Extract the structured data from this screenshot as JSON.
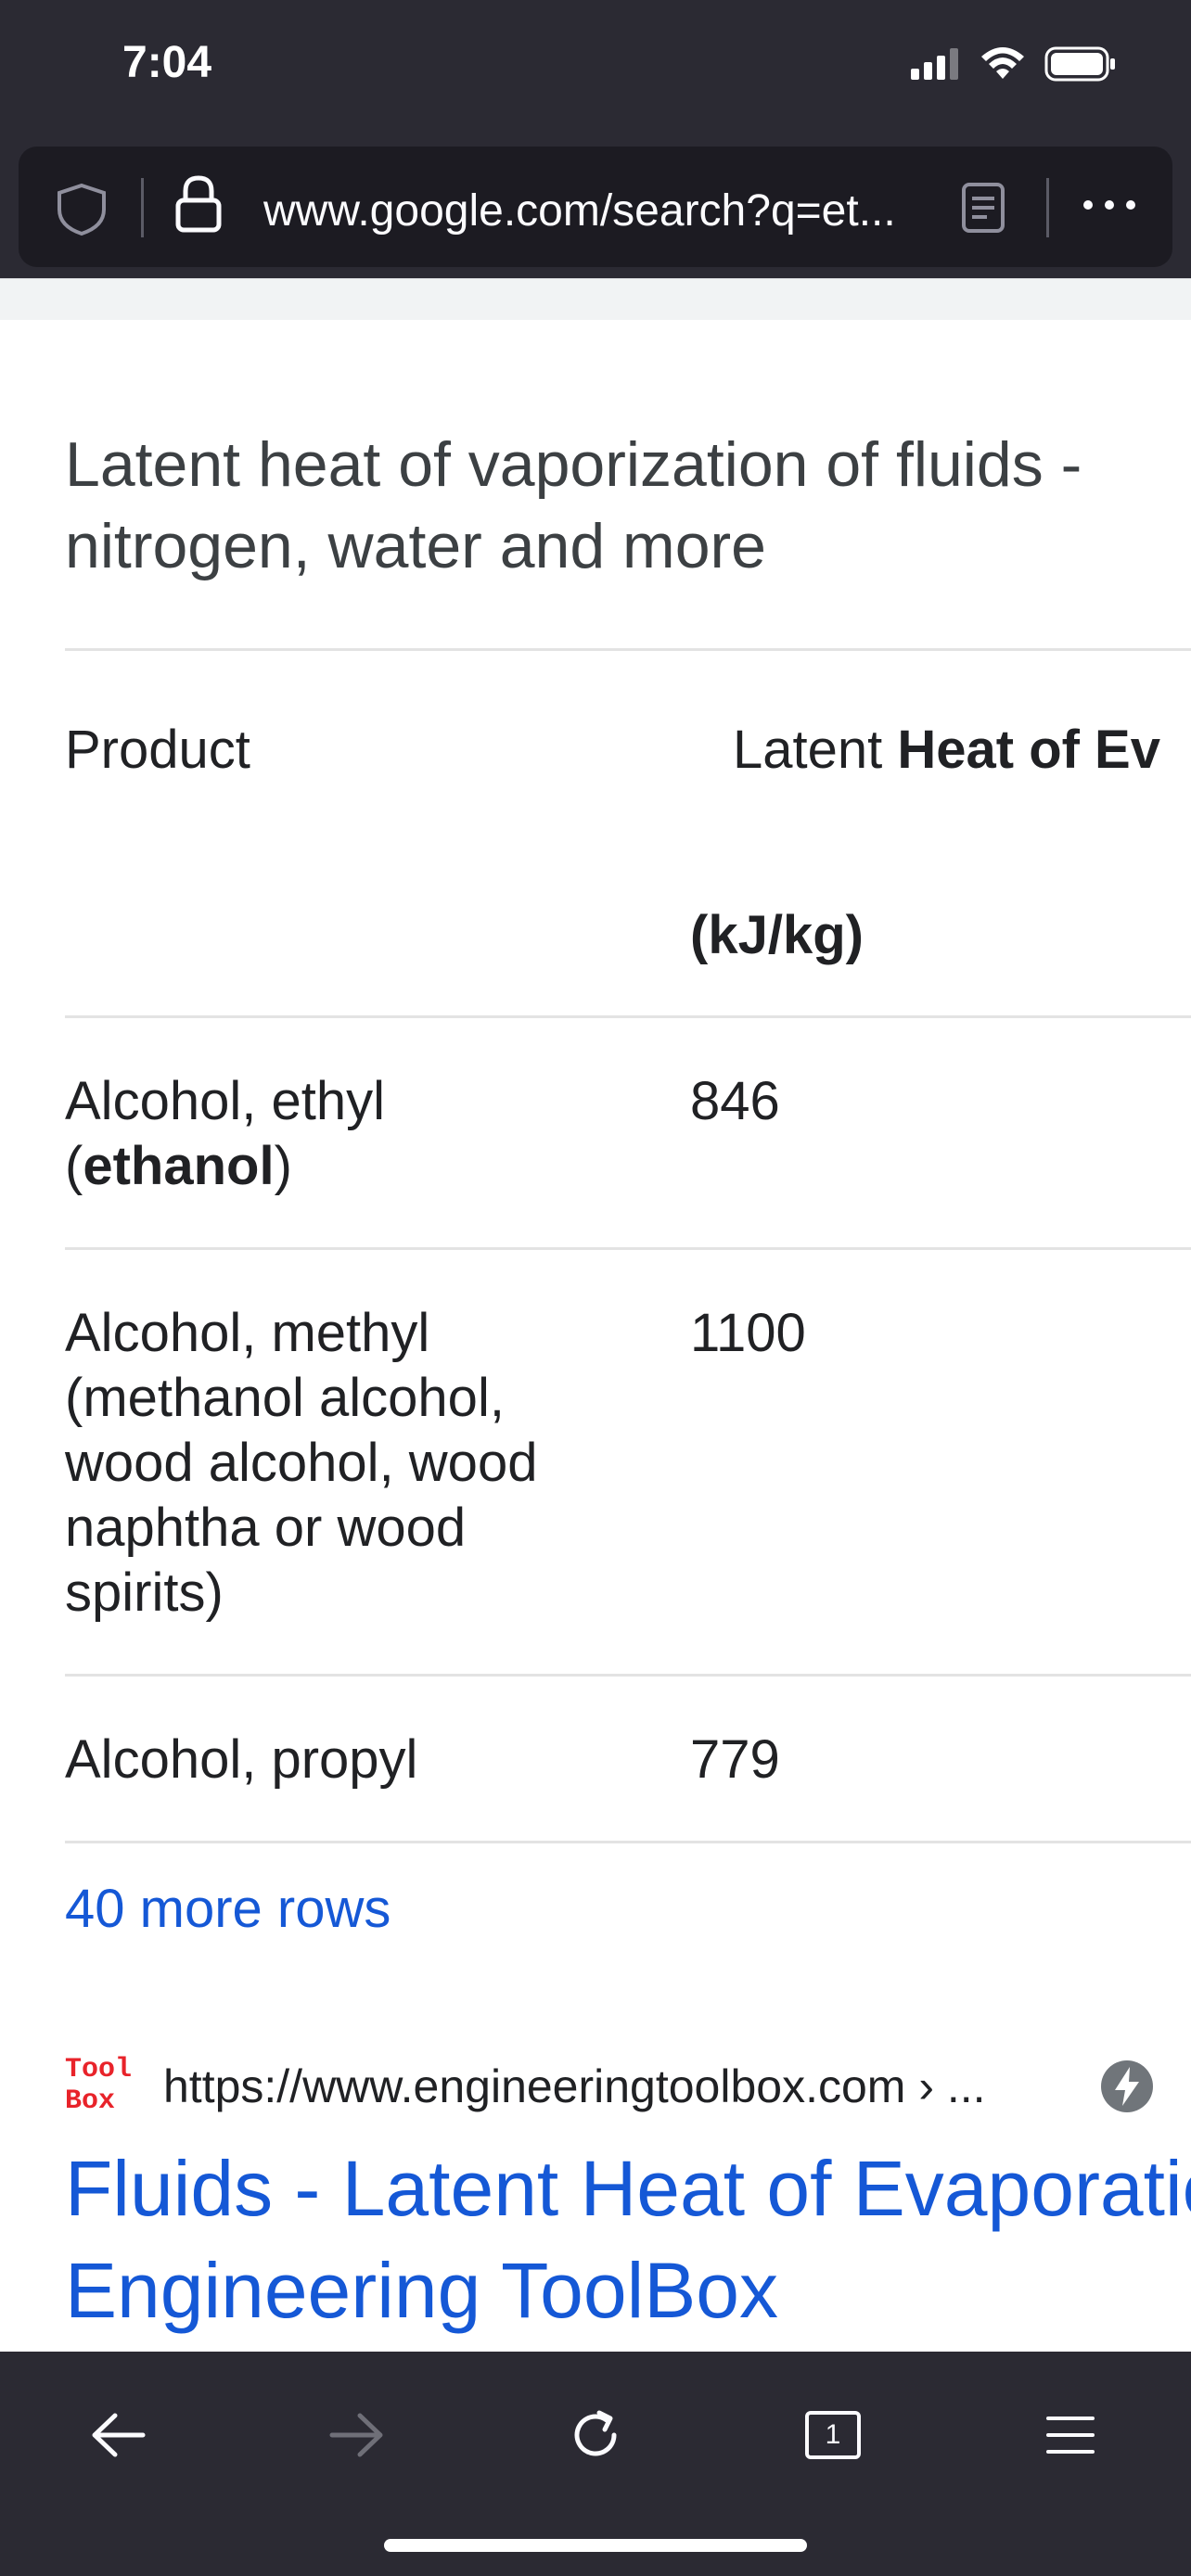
{
  "status": {
    "time": "7:04"
  },
  "browser": {
    "url": "www.google.com/search?q=et..."
  },
  "snippet": {
    "title": "Latent heat of vaporization of fluids - nitrogen, water and more",
    "headers": {
      "product": "Product",
      "latent_prefix": "Latent ",
      "latent_bold": "Heat of Ev",
      "unit": "(kJ/kg)"
    },
    "rows": [
      {
        "product_line1": "Alcohol, ethyl",
        "product_line2_open": "(",
        "product_line2_bold": "ethanol",
        "product_line2_close": ")",
        "value": "846"
      },
      {
        "product": "Alcohol, methyl (methanol alcohol, wood alcohol, wood naphtha or wood spirits)",
        "value": "1100"
      },
      {
        "product": "Alcohol, propyl",
        "value": "779"
      }
    ],
    "more_rows": "40 more rows"
  },
  "result": {
    "favicon_text_top": "Tool",
    "favicon_text_bottom": "Box",
    "cite": "https://www.engineeringtoolbox.com › ...",
    "title": "Fluids - Latent Heat of Evaporation - Engineering ToolBox"
  },
  "toolbar": {
    "tab_count": "1"
  },
  "colors": {
    "chrome": "#2b2a33",
    "link": "#1558d6",
    "text": "#202124"
  }
}
